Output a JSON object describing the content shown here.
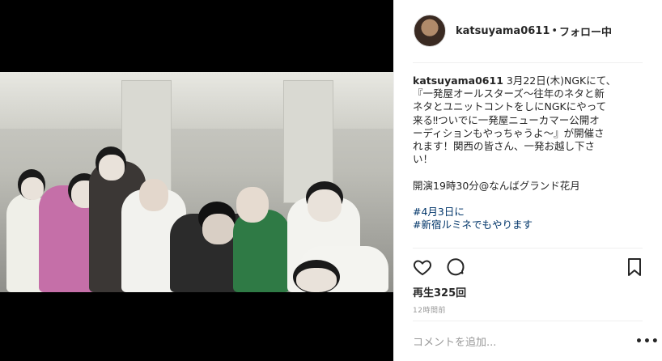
{
  "post": {
    "username": "katsuyama0611",
    "separator": "•",
    "follow_status": "フォロー中",
    "caption_lines": [
      "3月22日(木)NGKにて、",
      "『一発屋オールスターズ～往年のネタと新",
      "ネタとユニットコントをしにNGKにやって",
      "来る‼︎ついでに一発屋ニューカマー公開オ",
      "ーディションもやっちゃうよ～』が開催さ",
      "れます！関西の皆さん、一発お越し下さ",
      "い！",
      "",
      "開演19時30分@なんばグランド花月",
      ""
    ],
    "hashtags": [
      "#4月3日に",
      "#新宿ルミネでもやります"
    ],
    "views": "再生325回",
    "timestamp": "12時間前",
    "comment_placeholder": "コメントを追加...",
    "more_label": "•••"
  },
  "icons": {
    "like": "heart-icon",
    "comment": "comment-icon",
    "save": "bookmark-icon"
  }
}
